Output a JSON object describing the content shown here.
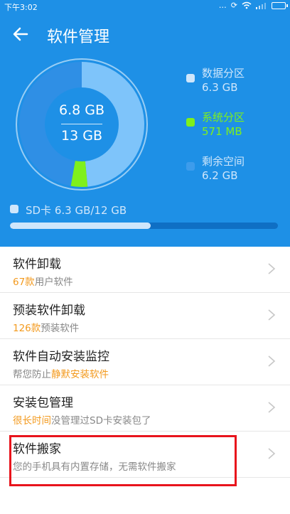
{
  "status_bar": {
    "time": "下午3:02",
    "signal": "…",
    "battery": ""
  },
  "header": {
    "title": "软件管理"
  },
  "storage": {
    "used": "6.8 GB",
    "total": "13 GB",
    "legend": [
      {
        "name": "数据分区",
        "value": "6.3 GB",
        "color": "#cfe6fb"
      },
      {
        "name": "系统分区",
        "value": "571 MB",
        "color": "#7ff01c"
      },
      {
        "name": "剩余空间",
        "value": "6.2 GB",
        "color": "#2f8fe5"
      }
    ],
    "segments": {
      "data_fraction": 0.485,
      "system_fraction": 0.043
    },
    "sd": {
      "label": "SD卡 6.3 GB/12 GB",
      "fraction": 0.525
    }
  },
  "list": [
    {
      "title": "软件卸载",
      "sub_highlight": "67款",
      "sub_rest": "用户软件"
    },
    {
      "title": "预装软件卸载",
      "sub_highlight": "126款",
      "sub_rest": "预装软件"
    },
    {
      "title": "软件自动安装监控",
      "sub_pre": "帮您防止",
      "sub_highlight": "静默安装软件"
    },
    {
      "title": "安装包管理",
      "sub_highlight": "很长时间",
      "sub_rest": "没管理过SD卡安装包了"
    },
    {
      "title": "软件搬家",
      "sub_rest": "您的手机具有内置存储，无需软件搬家"
    }
  ]
}
